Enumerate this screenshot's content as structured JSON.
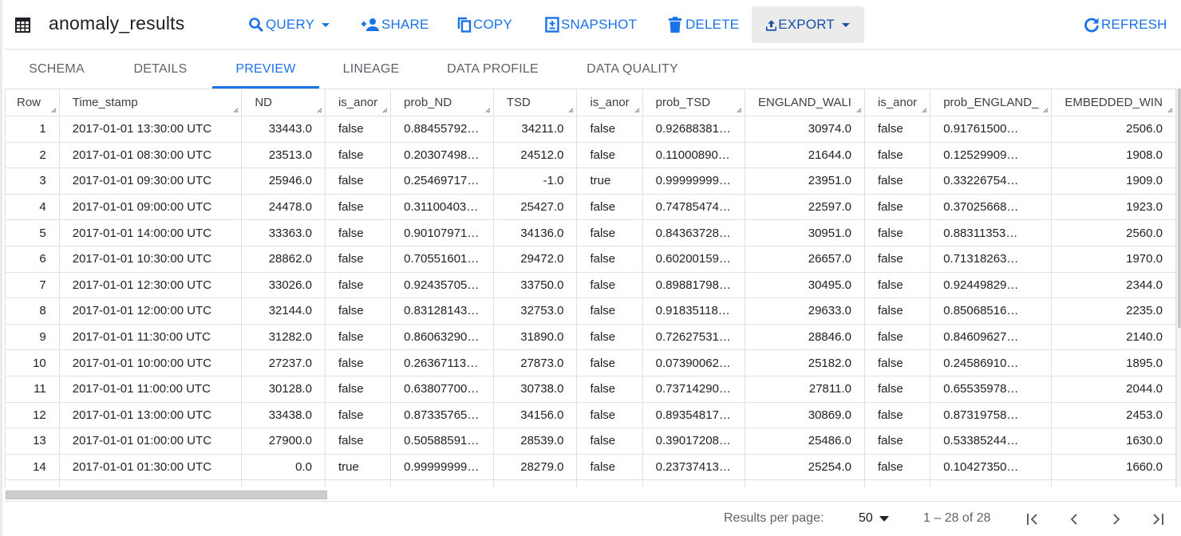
{
  "header": {
    "title": "anomaly_results",
    "title_icon": "table-icon",
    "actions": [
      {
        "label": "QUERY",
        "icon": "search-icon",
        "has_dropdown": true
      },
      {
        "label": "SHARE",
        "icon": "person-add-icon",
        "has_dropdown": false
      },
      {
        "label": "COPY",
        "icon": "copy-icon",
        "has_dropdown": false
      },
      {
        "label": "SNAPSHOT",
        "icon": "snapshot-icon",
        "has_dropdown": false
      },
      {
        "label": "DELETE",
        "icon": "trash-icon",
        "has_dropdown": false
      },
      {
        "label": "EXPORT",
        "icon": "upload-icon",
        "has_dropdown": true
      },
      {
        "label": "REFRESH",
        "icon": "refresh-icon",
        "has_dropdown": false
      }
    ]
  },
  "tabs": [
    {
      "label": "SCHEMA",
      "active": false
    },
    {
      "label": "DETAILS",
      "active": false
    },
    {
      "label": "PREVIEW",
      "active": true
    },
    {
      "label": "LINEAGE",
      "active": false
    },
    {
      "label": "DATA PROFILE",
      "active": false
    },
    {
      "label": "DATA QUALITY",
      "active": false
    }
  ],
  "table": {
    "columns": [
      "Row",
      "Time_stamp",
      "ND",
      "is_anor",
      "prob_ND",
      "TSD",
      "is_anor",
      "prob_TSD",
      "ENGLAND_WALI",
      "is_anor",
      "prob_ENGLAND_",
      "EMBEDDED_WIN"
    ],
    "rows": [
      [
        "1",
        "2017-01-01 13:30:00 UTC",
        "33443.0",
        "false",
        "0.88455792…",
        "34211.0",
        "false",
        "0.92688381…",
        "30974.0",
        "false",
        "0.91761500…",
        "2506.0"
      ],
      [
        "2",
        "2017-01-01 08:30:00 UTC",
        "23513.0",
        "false",
        "0.20307498…",
        "24512.0",
        "false",
        "0.11000890…",
        "21644.0",
        "false",
        "0.12529909…",
        "1908.0"
      ],
      [
        "3",
        "2017-01-01 09:30:00 UTC",
        "25946.0",
        "false",
        "0.25469717…",
        "-1.0",
        "true",
        "0.99999999…",
        "23951.0",
        "false",
        "0.33226754…",
        "1909.0"
      ],
      [
        "4",
        "2017-01-01 09:00:00 UTC",
        "24478.0",
        "false",
        "0.31100403…",
        "25427.0",
        "false",
        "0.74785474…",
        "22597.0",
        "false",
        "0.37025668…",
        "1923.0"
      ],
      [
        "5",
        "2017-01-01 14:00:00 UTC",
        "33363.0",
        "false",
        "0.90107971…",
        "34136.0",
        "false",
        "0.84363728…",
        "30951.0",
        "false",
        "0.88311353…",
        "2560.0"
      ],
      [
        "6",
        "2017-01-01 10:30:00 UTC",
        "28862.0",
        "false",
        "0.70551601…",
        "29472.0",
        "false",
        "0.60200159…",
        "26657.0",
        "false",
        "0.71318263…",
        "1970.0"
      ],
      [
        "7",
        "2017-01-01 12:30:00 UTC",
        "33026.0",
        "false",
        "0.92435705…",
        "33750.0",
        "false",
        "0.89881798…",
        "30495.0",
        "false",
        "0.92449829…",
        "2344.0"
      ],
      [
        "8",
        "2017-01-01 12:00:00 UTC",
        "32144.0",
        "false",
        "0.83128143…",
        "32753.0",
        "false",
        "0.91835118…",
        "29633.0",
        "false",
        "0.85068516…",
        "2235.0"
      ],
      [
        "9",
        "2017-01-01 11:30:00 UTC",
        "31282.0",
        "false",
        "0.86063290…",
        "31890.0",
        "false",
        "0.72627531…",
        "28846.0",
        "false",
        "0.84609627…",
        "2140.0"
      ],
      [
        "10",
        "2017-01-01 10:00:00 UTC",
        "27237.0",
        "false",
        "0.26367113…",
        "27873.0",
        "false",
        "0.07390062…",
        "25182.0",
        "false",
        "0.24586910…",
        "1895.0"
      ],
      [
        "11",
        "2017-01-01 11:00:00 UTC",
        "30128.0",
        "false",
        "0.63807700…",
        "30738.0",
        "false",
        "0.73714290…",
        "27811.0",
        "false",
        "0.65535978…",
        "2044.0"
      ],
      [
        "12",
        "2017-01-01 13:00:00 UTC",
        "33438.0",
        "false",
        "0.87335765…",
        "34156.0",
        "false",
        "0.89354817…",
        "30869.0",
        "false",
        "0.87319758…",
        "2453.0"
      ],
      [
        "13",
        "2017-01-01 01:00:00 UTC",
        "27900.0",
        "false",
        "0.50588591…",
        "28539.0",
        "false",
        "0.39017208…",
        "25486.0",
        "false",
        "0.53385244…",
        "1630.0"
      ],
      [
        "14",
        "2017-01-01 01:30:00 UTC",
        "0.0",
        "true",
        "0.99999999…",
        "28279.0",
        "false",
        "0.23737413…",
        "25254.0",
        "false",
        "0.10427350…",
        "1660.0"
      ]
    ]
  },
  "pagination": {
    "results_per_page_label": "Results per page:",
    "results_per_page_value": "50",
    "range_text": "1 – 28 of 28",
    "buttons": [
      "first-page",
      "previous-page",
      "next-page",
      "last-page"
    ]
  },
  "colors": {
    "accent": "#1a73e8",
    "export_bg": "#ebebeb",
    "border": "#e0e0e0"
  }
}
